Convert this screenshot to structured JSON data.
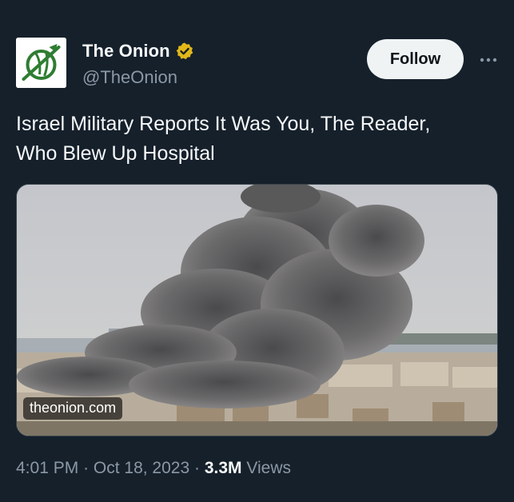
{
  "author": {
    "name": "The Onion",
    "handle": "@TheOnion",
    "verified": true,
    "avatar_icon": "onion-logo-icon",
    "badge_color": "#e2b719"
  },
  "actions": {
    "follow_label": "Follow",
    "more_icon": "more-dots-icon"
  },
  "tweet": {
    "text_line1": "Israel Military Reports It Was You, The Reader,",
    "text_line2": "Who Blew Up Hospital"
  },
  "media": {
    "image_description_icon": "smoke-cloud-photo",
    "link_label": "theonion.com"
  },
  "meta": {
    "time": "4:01 PM",
    "separator1": "·",
    "date": "Oct 18, 2023",
    "separator2": "·",
    "views_count": "3.3M",
    "views_label": "Views"
  },
  "colors": {
    "background": "#15202b",
    "text_primary": "#f7f9f9",
    "text_secondary": "#8b98a5",
    "follow_bg": "#eff3f4",
    "logo_green": "#2e7d32"
  }
}
